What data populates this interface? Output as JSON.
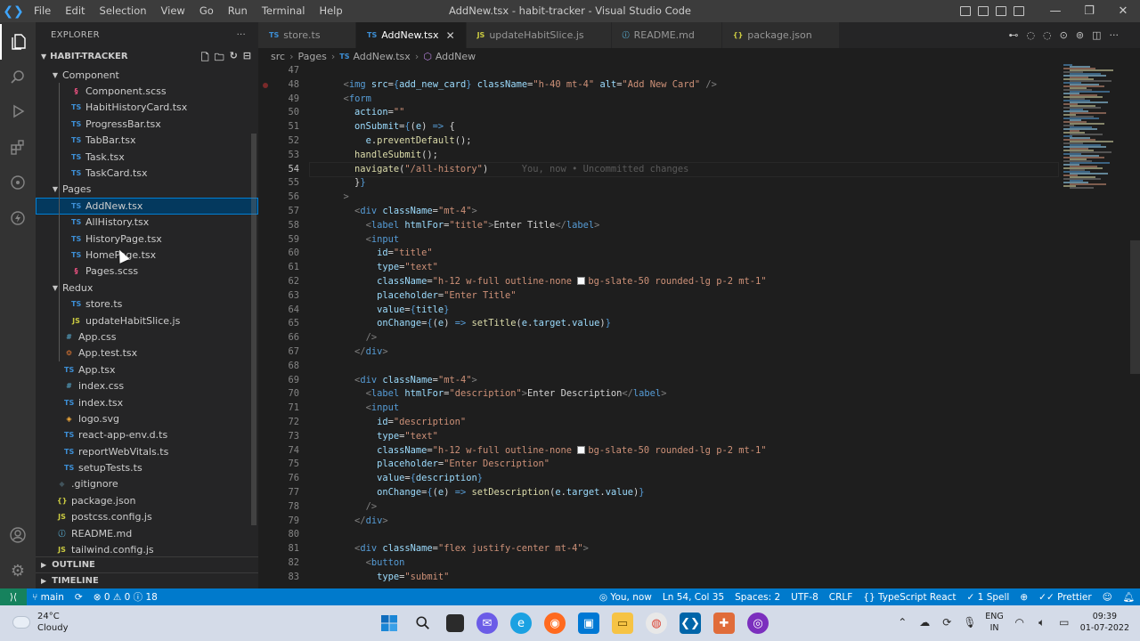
{
  "titlebar": {
    "menu": [
      "File",
      "Edit",
      "Selection",
      "View",
      "Go",
      "Run",
      "Terminal",
      "Help"
    ],
    "window_title": "AddNew.tsx - habit-tracker - Visual Studio Code"
  },
  "explorer": {
    "header": "EXPLORER",
    "more": "···",
    "root": "HABIT-TRACKER",
    "rows": [
      {
        "label": "Component",
        "type": "folder",
        "depth": 1,
        "open": true
      },
      {
        "label": "Component.scss",
        "type": "scss",
        "icon": "§",
        "depth": 2
      },
      {
        "label": "HabitHistoryCard.tsx",
        "type": "ts",
        "icon": "TS",
        "depth": 2
      },
      {
        "label": "ProgressBar.tsx",
        "type": "ts",
        "icon": "TS",
        "depth": 2
      },
      {
        "label": "TabBar.tsx",
        "type": "ts",
        "icon": "TS",
        "depth": 2
      },
      {
        "label": "Task.tsx",
        "type": "ts",
        "icon": "TS",
        "depth": 2
      },
      {
        "label": "TaskCard.tsx",
        "type": "ts",
        "icon": "TS",
        "depth": 2
      },
      {
        "label": "Pages",
        "type": "folder",
        "depth": 1,
        "open": true
      },
      {
        "label": "AddNew.tsx",
        "type": "ts",
        "icon": "TS",
        "depth": 2,
        "selected": true
      },
      {
        "label": "AllHistory.tsx",
        "type": "ts",
        "icon": "TS",
        "depth": 2
      },
      {
        "label": "HistoryPage.tsx",
        "type": "ts",
        "icon": "TS",
        "depth": 2
      },
      {
        "label": "HomePage.tsx",
        "type": "ts",
        "icon": "TS",
        "depth": 2
      },
      {
        "label": "Pages.scss",
        "type": "scss",
        "icon": "§",
        "depth": 2
      },
      {
        "label": "Redux",
        "type": "folder",
        "depth": 1,
        "open": true
      },
      {
        "label": "store.ts",
        "type": "ts",
        "icon": "TS",
        "depth": 2
      },
      {
        "label": "updateHabitSlice.js",
        "type": "js",
        "icon": "JS",
        "depth": 2
      },
      {
        "label": "App.css",
        "type": "css",
        "icon": "#",
        "depth": 1
      },
      {
        "label": "App.test.tsx",
        "type": "test",
        "icon": "⚙",
        "depth": 1
      },
      {
        "label": "App.tsx",
        "type": "ts",
        "icon": "TS",
        "depth": 1
      },
      {
        "label": "index.css",
        "type": "css",
        "icon": "#",
        "depth": 1
      },
      {
        "label": "index.tsx",
        "type": "ts",
        "icon": "TS",
        "depth": 1
      },
      {
        "label": "logo.svg",
        "type": "svg",
        "icon": "◈",
        "depth": 1
      },
      {
        "label": "react-app-env.d.ts",
        "type": "ts",
        "icon": "TS",
        "depth": 1
      },
      {
        "label": "reportWebVitals.ts",
        "type": "ts",
        "icon": "TS",
        "depth": 1
      },
      {
        "label": "setupTests.ts",
        "type": "ts",
        "icon": "TS",
        "depth": 1
      },
      {
        "label": ".gitignore",
        "type": "git",
        "icon": "◆",
        "depth": 0
      },
      {
        "label": "package.json",
        "type": "json",
        "icon": "{}",
        "depth": 0
      },
      {
        "label": "postcss.config.js",
        "type": "js",
        "icon": "JS",
        "depth": 0
      },
      {
        "label": "README.md",
        "type": "md",
        "icon": "ⓘ",
        "depth": 0
      },
      {
        "label": "tailwind.config.js",
        "type": "js",
        "icon": "JS",
        "depth": 0
      }
    ],
    "outline": "OUTLINE",
    "timeline": "TIMELINE"
  },
  "tabs": [
    {
      "label": "store.ts",
      "icon": "TS",
      "type": "ts"
    },
    {
      "label": "AddNew.tsx",
      "icon": "TS",
      "type": "ts",
      "active": true
    },
    {
      "label": "updateHabitSlice.js",
      "icon": "JS",
      "type": "js"
    },
    {
      "label": "README.md",
      "icon": "ⓘ",
      "type": "md"
    },
    {
      "label": "package.json",
      "icon": "{}",
      "type": "json"
    }
  ],
  "breadcrumb": [
    "src",
    "Pages",
    "AddNew.tsx",
    "AddNew"
  ],
  "editor": {
    "current_line": 54,
    "blame": "You, now • Uncommitted changes",
    "lines": [
      {
        "n": 47,
        "html": ""
      },
      {
        "n": 48,
        "html": "      <span class='tg'>&lt;</span><span class='tn'>img</span> <span class='at'>src</span><span class='pl'>=</span><span class='br'>{</span><span class='vr'>add_new_card</span><span class='br'>}</span> <span class='at'>className</span><span class='pl'>=</span><span class='st'>\"h-40 mt-4\"</span> <span class='at'>alt</span><span class='pl'>=</span><span class='st'>\"Add New Card\"</span> <span class='tg'>/&gt;</span>"
      },
      {
        "n": 49,
        "html": "      <span class='tg'>&lt;</span><span class='tn'>form</span>"
      },
      {
        "n": 50,
        "html": "        <span class='at'>action</span><span class='pl'>=</span><span class='st'>\"\"</span>"
      },
      {
        "n": 51,
        "html": "        <span class='at'>onSubmit</span><span class='pl'>=</span><span class='br'>{</span><span class='pl'>(</span><span class='vr'>e</span><span class='pl'>) </span><span class='br'>=&gt;</span><span class='pl'> {</span>"
      },
      {
        "n": 52,
        "html": "          <span class='vr'>e</span><span class='pl'>.</span><span class='fn'>preventDefault</span><span class='pl'>();</span>"
      },
      {
        "n": 53,
        "html": "        <span class='fn'>handleSubmit</span><span class='pl'>();</span>"
      },
      {
        "n": 54,
        "html": "        <span class='fn'>navigate</span><span class='pl'>(</span><span class='st'>\"/all-history\"</span><span class='pl'>)</span>"
      },
      {
        "n": 55,
        "html": "        <span class='pl'>}</span><span class='br'>}</span>"
      },
      {
        "n": 56,
        "html": "      <span class='tg'>&gt;</span>"
      },
      {
        "n": 57,
        "html": "        <span class='tg'>&lt;</span><span class='tn'>div</span> <span class='at'>className</span><span class='pl'>=</span><span class='st'>\"mt-4\"</span><span class='tg'>&gt;</span>"
      },
      {
        "n": 58,
        "html": "          <span class='tg'>&lt;</span><span class='tn'>label</span> <span class='at'>htmlFor</span><span class='pl'>=</span><span class='st'>\"title\"</span><span class='tg'>&gt;</span><span class='pl'>Enter Title</span><span class='tg'>&lt;/</span><span class='tn'>label</span><span class='tg'>&gt;</span>"
      },
      {
        "n": 59,
        "html": "          <span class='tg'>&lt;</span><span class='tn'>input</span>"
      },
      {
        "n": 60,
        "html": "            <span class='at'>id</span><span class='pl'>=</span><span class='st'>\"title\"</span>"
      },
      {
        "n": 61,
        "html": "            <span class='at'>type</span><span class='pl'>=</span><span class='st'>\"text\"</span>"
      },
      {
        "n": 62,
        "html": "            <span class='at'>className</span><span class='pl'>=</span><span class='st'>\"h-12 w-full outline-none <span class='swatch'></span>bg-slate-50 rounded-lg p-2 mt-1\"</span>"
      },
      {
        "n": 63,
        "html": "            <span class='at'>placeholder</span><span class='pl'>=</span><span class='st'>\"Enter Title\"</span>"
      },
      {
        "n": 64,
        "html": "            <span class='at'>value</span><span class='pl'>=</span><span class='br'>{</span><span class='vr'>title</span><span class='br'>}</span>"
      },
      {
        "n": 65,
        "html": "            <span class='at'>onChange</span><span class='pl'>=</span><span class='br'>{</span><span class='pl'>(</span><span class='vr'>e</span><span class='pl'>) </span><span class='br'>=&gt;</span><span class='pl'> </span><span class='fn'>setTitle</span><span class='pl'>(</span><span class='vr'>e</span><span class='pl'>.</span><span class='vr'>target</span><span class='pl'>.</span><span class='vr'>value</span><span class='pl'>)</span><span class='br'>}</span>"
      },
      {
        "n": 66,
        "html": "          <span class='tg'>/&gt;</span>"
      },
      {
        "n": 67,
        "html": "        <span class='tg'>&lt;/</span><span class='tn'>div</span><span class='tg'>&gt;</span>"
      },
      {
        "n": 68,
        "html": ""
      },
      {
        "n": 69,
        "html": "        <span class='tg'>&lt;</span><span class='tn'>div</span> <span class='at'>className</span><span class='pl'>=</span><span class='st'>\"mt-4\"</span><span class='tg'>&gt;</span>"
      },
      {
        "n": 70,
        "html": "          <span class='tg'>&lt;</span><span class='tn'>label</span> <span class='at'>htmlFor</span><span class='pl'>=</span><span class='st'>\"description\"</span><span class='tg'>&gt;</span><span class='pl'>Enter Description</span><span class='tg'>&lt;/</span><span class='tn'>label</span><span class='tg'>&gt;</span>"
      },
      {
        "n": 71,
        "html": "          <span class='tg'>&lt;</span><span class='tn'>input</span>"
      },
      {
        "n": 72,
        "html": "            <span class='at'>id</span><span class='pl'>=</span><span class='st'>\"description\"</span>"
      },
      {
        "n": 73,
        "html": "            <span class='at'>type</span><span class='pl'>=</span><span class='st'>\"text\"</span>"
      },
      {
        "n": 74,
        "html": "            <span class='at'>className</span><span class='pl'>=</span><span class='st'>\"h-12 w-full outline-none <span class='swatch'></span>bg-slate-50 rounded-lg p-2 mt-1\"</span>"
      },
      {
        "n": 75,
        "html": "            <span class='at'>placeholder</span><span class='pl'>=</span><span class='st'>\"Enter Description\"</span>"
      },
      {
        "n": 76,
        "html": "            <span class='at'>value</span><span class='pl'>=</span><span class='br'>{</span><span class='vr'>description</span><span class='br'>}</span>"
      },
      {
        "n": 77,
        "html": "            <span class='at'>onChange</span><span class='pl'>=</span><span class='br'>{</span><span class='pl'>(</span><span class='vr'>e</span><span class='pl'>) </span><span class='br'>=&gt;</span><span class='pl'> </span><span class='fn'>setDescription</span><span class='pl'>(</span><span class='vr'>e</span><span class='pl'>.</span><span class='vr'>target</span><span class='pl'>.</span><span class='vr'>value</span><span class='pl'>)</span><span class='br'>}</span>"
      },
      {
        "n": 78,
        "html": "          <span class='tg'>/&gt;</span>"
      },
      {
        "n": 79,
        "html": "        <span class='tg'>&lt;/</span><span class='tn'>div</span><span class='tg'>&gt;</span>"
      },
      {
        "n": 80,
        "html": ""
      },
      {
        "n": 81,
        "html": "        <span class='tg'>&lt;</span><span class='tn'>div</span> <span class='at'>className</span><span class='pl'>=</span><span class='st'>\"flex justify-center mt-4\"</span><span class='tg'>&gt;</span>"
      },
      {
        "n": 82,
        "html": "          <span class='tg'>&lt;</span><span class='tn'>button</span>"
      },
      {
        "n": 83,
        "html": "            <span class='at'>type</span><span class='pl'>=</span><span class='st'>\"submit\"</span>"
      }
    ]
  },
  "statusbar": {
    "branch": "main",
    "errors": "0",
    "warnings": "0",
    "info": "18",
    "blame": "You, now",
    "position": "Ln 54, Col 35",
    "spaces": "Spaces: 2",
    "encoding": "UTF-8",
    "eol": "CRLF",
    "language": "TypeScript React",
    "spell": "1 Spell",
    "prettier": "Prettier"
  },
  "taskbar": {
    "temp": "24°C",
    "condition": "Cloudy",
    "lang_top": "ENG",
    "lang_bottom": "IN",
    "time": "09:39",
    "date": "01-07-2022"
  }
}
